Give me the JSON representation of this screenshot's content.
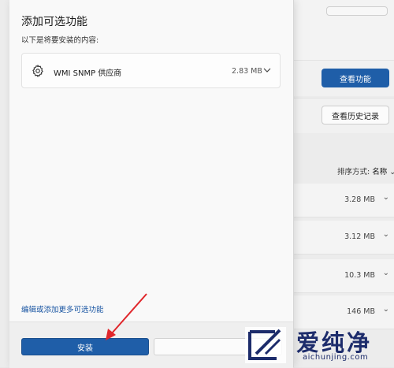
{
  "background": {
    "view_features_button": "查看功能",
    "view_history_button": "查看历史记录",
    "sort_label": "排序方式:",
    "sort_value": "名称",
    "rows": [
      {
        "size": "3.28 MB"
      },
      {
        "size": "3.12 MB"
      },
      {
        "size": "10.3 MB"
      },
      {
        "size": "146 MB"
      }
    ]
  },
  "dialog": {
    "title": "添加可选功能",
    "subtitle": "以下是将要安装的内容:",
    "feature": {
      "name": "WMI SNMP 供应商",
      "size": "2.83 MB"
    },
    "more_link": "编辑或添加更多可选功能",
    "install_button": "安装",
    "cancel_button": ""
  },
  "watermark": {
    "brand_cn": "爱纯净",
    "brand_en": "aichunjing.com"
  },
  "colors": {
    "accent": "#1f5ea8",
    "annotation": "#e0262b",
    "watermark": "#1d2c6b"
  },
  "icons": {
    "feature": "gear-icon",
    "expand": "chevron-down-icon"
  }
}
